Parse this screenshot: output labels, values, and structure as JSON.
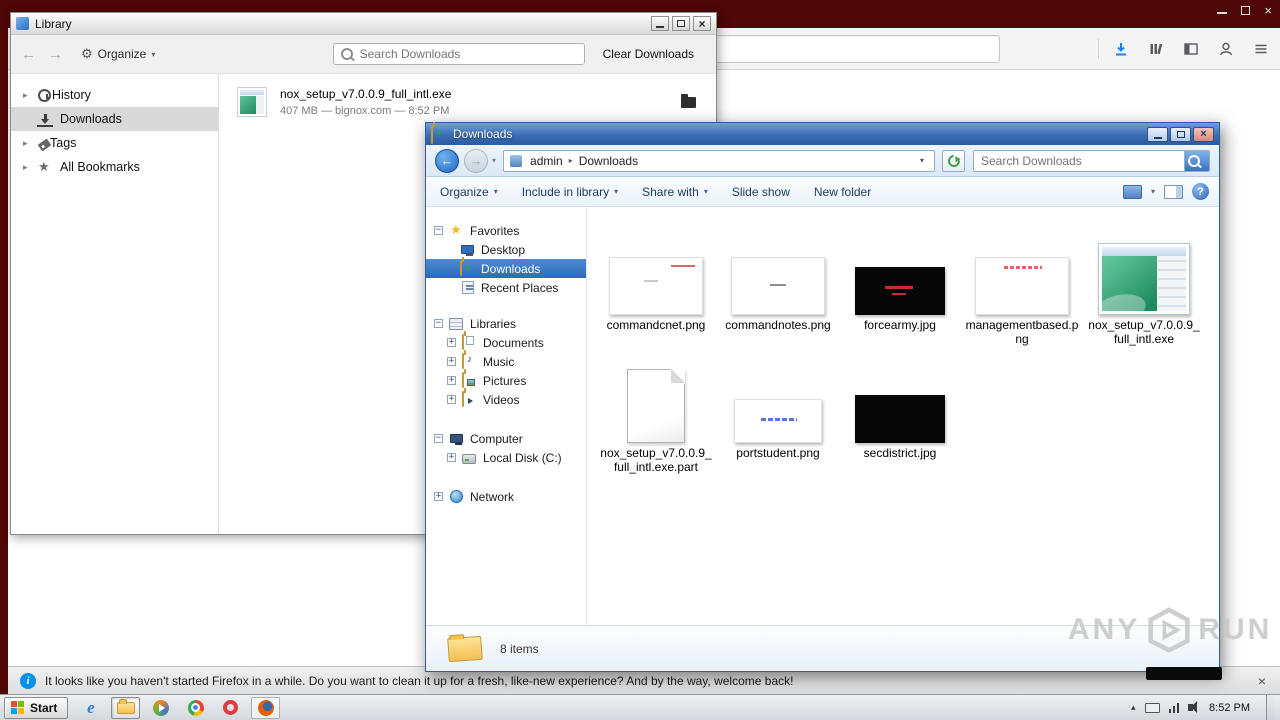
{
  "colors": {
    "desktop": "#4e0606",
    "explorer_titlebar": "#3a6db5",
    "tree_selection": "#2f6ab8",
    "firefox_accent": "#0a84ff"
  },
  "browser": {
    "toolbar_icons": [
      "download",
      "library",
      "sidebar",
      "account",
      "menu"
    ]
  },
  "library_window": {
    "title": "Library",
    "toolbar": {
      "organize": "Organize",
      "search_placeholder": "Search Downloads",
      "clear": "Clear Downloads"
    },
    "sidebar": [
      {
        "label": "History"
      },
      {
        "label": "Downloads"
      },
      {
        "label": "Tags"
      },
      {
        "label": "All Bookmarks"
      }
    ],
    "download": {
      "name": "nox_setup_v7.0.0.9_full_intl.exe",
      "details": "407 MB — bignox.com — 8:52 PM"
    }
  },
  "explorer": {
    "title": "Downloads",
    "breadcrumb": {
      "root": "admin",
      "current": "Downloads"
    },
    "search_placeholder": "Search Downloads",
    "commands": [
      "Organize",
      "Include in library",
      "Share with",
      "Slide show",
      "New folder"
    ],
    "tree": {
      "favorites": "Favorites",
      "desktop": "Desktop",
      "downloads": "Downloads",
      "recent": "Recent Places",
      "libraries": "Libraries",
      "documents": "Documents",
      "music": "Music",
      "pictures": "Pictures",
      "videos": "Videos",
      "computer": "Computer",
      "disk": "Local Disk (C:)",
      "network": "Network"
    },
    "files": [
      {
        "name": "commandcnet.png"
      },
      {
        "name": "commandnotes.png"
      },
      {
        "name": "forcearmy.jpg"
      },
      {
        "name": "managementbased.png"
      },
      {
        "name": "nox_setup_v7.0.0.9_full_intl.exe"
      },
      {
        "name": "nox_setup_v7.0.0.9_full_intl.exe.part"
      },
      {
        "name": "portstudent.png"
      },
      {
        "name": "secdistrict.jpg"
      }
    ],
    "status": "8 items"
  },
  "notification": {
    "text": "It looks like you haven't started Firefox in a while. Do you want to clean it up for a fresh, like-new experience? And by the way, welcome back!"
  },
  "taskbar": {
    "start": "Start",
    "clock": "8:52 PM"
  },
  "watermark": {
    "any": "ANY",
    "run": "RUN"
  }
}
